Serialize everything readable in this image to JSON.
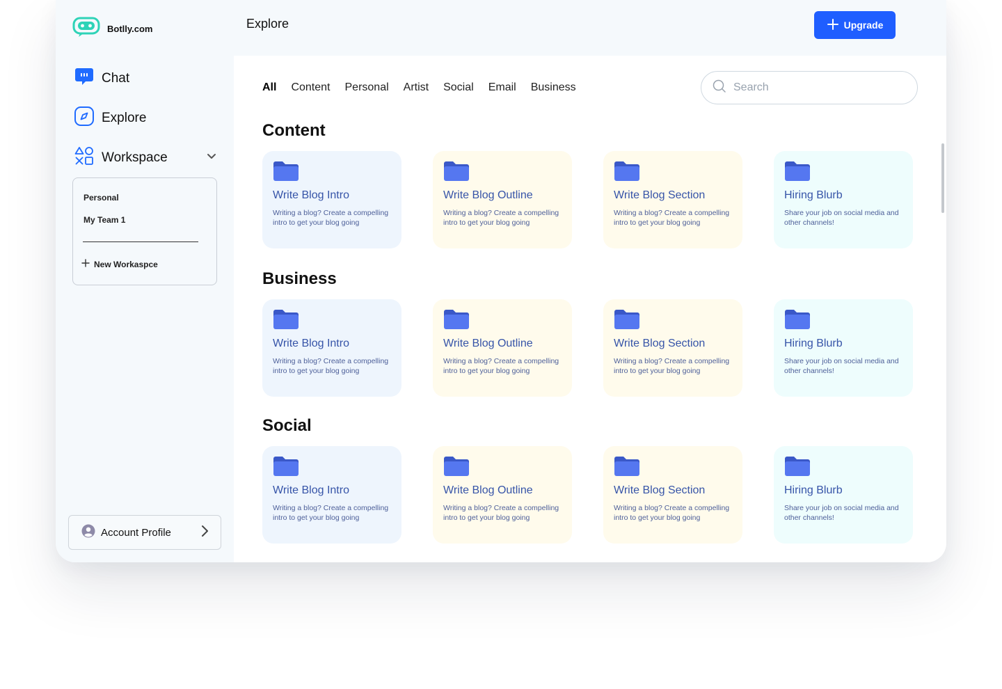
{
  "app": {
    "name": "Botlly.com"
  },
  "sidebar": {
    "nav": [
      {
        "label": "Chat",
        "icon": "chat-bubble-icon"
      },
      {
        "label": "Explore",
        "icon": "compass-icon"
      },
      {
        "label": "Workspace",
        "icon": "shapes-icon"
      }
    ],
    "workspace": {
      "items": [
        "Personal",
        "My Team 1"
      ],
      "new_label": "New Workaspce"
    },
    "account_label": "Account Profile"
  },
  "header": {
    "title": "Explore",
    "upgrade_label": "Upgrade"
  },
  "tabs": [
    "All",
    "Content",
    "Personal",
    "Artist",
    "Social",
    "Email",
    "Business"
  ],
  "active_tab": "All",
  "search": {
    "placeholder": "Search"
  },
  "sections": [
    {
      "title": "Content",
      "cards": [
        {
          "title": "Write Blog Intro",
          "desc": "Writing a blog? Create a compelling intro to get your blog going"
        },
        {
          "title": "Write Blog Outline",
          "desc": "Writing a blog? Create a compelling intro to get your blog going"
        },
        {
          "title": "Write Blog Section",
          "desc": "Writing a blog? Create a compelling intro to get your blog going"
        },
        {
          "title": "Hiring Blurb",
          "desc": "Share your job on social media and other channels!"
        }
      ]
    },
    {
      "title": "Business",
      "cards": [
        {
          "title": "Write Blog Intro",
          "desc": "Writing a blog? Create a compelling intro to get your blog going"
        },
        {
          "title": "Write Blog Outline",
          "desc": "Writing a blog? Create a compelling intro to get your blog going"
        },
        {
          "title": "Write Blog Section",
          "desc": "Writing a blog? Create a compelling intro to get your blog going"
        },
        {
          "title": "Hiring Blurb",
          "desc": "Share your job on social media and other channels!"
        }
      ]
    },
    {
      "title": "Social",
      "cards": [
        {
          "title": "Write Blog Intro",
          "desc": "Writing a blog? Create a compelling intro to get your blog going"
        },
        {
          "title": "Write Blog Outline",
          "desc": "Writing a blog? Create a compelling intro to get your blog going"
        },
        {
          "title": "Write Blog Section",
          "desc": "Writing a blog? Create a compelling intro to get your blog going"
        },
        {
          "title": "Hiring Blurb",
          "desc": "Share your job on social media and other channels!"
        }
      ]
    }
  ],
  "colors": {
    "accent": "#1f5eff",
    "logo": "#2ed3b7",
    "card_title": "#3654a8",
    "folder": "#4f72f0",
    "card_backgrounds": [
      "#eef5fd",
      "#fffbec",
      "#fffbec",
      "#eefdfd"
    ]
  }
}
